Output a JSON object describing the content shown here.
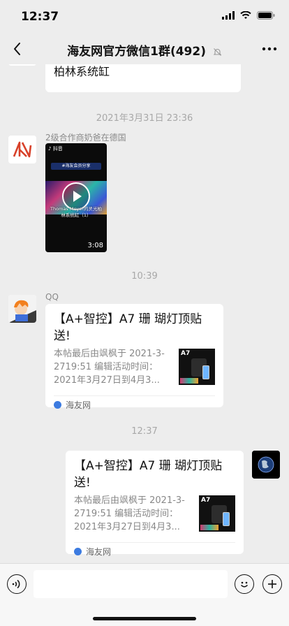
{
  "status_bar": {
    "time": "12:37"
  },
  "nav": {
    "title": "海友网官方微信1群(492)"
  },
  "messages": {
    "partial_text": "德国大神 Thomas Meyer 的灵光柏林系统缸",
    "ts1": "2021年3月31日 23:36",
    "sender1": "2级合作商奶爸在德国",
    "video": {
      "app": "抖音",
      "tag": "#海友会员分享",
      "subtitle": "Thomas Meyer的灵光柏林系统缸（1）",
      "duration": "3:08"
    },
    "ts2": "10:39",
    "sender2": "QQ",
    "card": {
      "title": "【A+智控】A7 珊 瑚灯顶贴送!",
      "desc": "本帖最后由飒枫于 2021-3-2719:51 编辑活动时间：2021年3月27日到4月3...",
      "thumb_label": "A7",
      "source": "海友网"
    },
    "ts3": "12:37",
    "card_self": {
      "title": "【A+智控】A7 珊 瑚灯顶贴送!",
      "desc": "本帖最后由飒枫于 2021-3-2719:51 编辑活动时间：2021年3月27日到4月3...",
      "thumb_label": "A7",
      "source": "海友网"
    }
  },
  "colors": {
    "background": "#ededed",
    "bubble": "#ffffff",
    "timestamp": "#a8a8a8",
    "source_icon": "#3c7be0"
  }
}
